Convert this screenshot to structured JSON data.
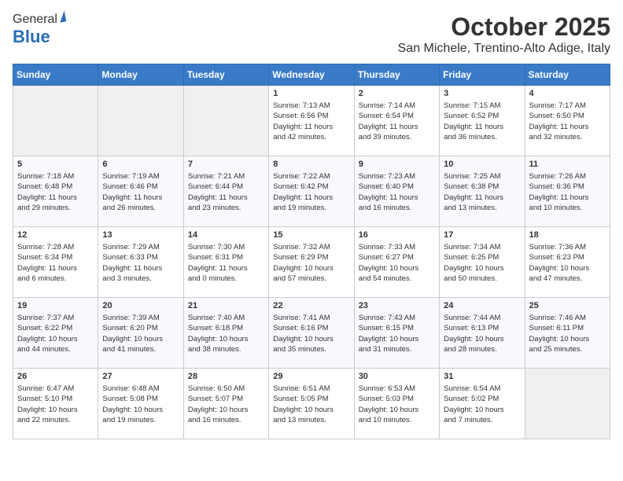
{
  "logo": {
    "general": "General",
    "blue": "Blue"
  },
  "header": {
    "month": "October 2025",
    "location": "San Michele, Trentino-Alto Adige, Italy"
  },
  "weekdays": [
    "Sunday",
    "Monday",
    "Tuesday",
    "Wednesday",
    "Thursday",
    "Friday",
    "Saturday"
  ],
  "weeks": [
    [
      {
        "day": "",
        "info": ""
      },
      {
        "day": "",
        "info": ""
      },
      {
        "day": "",
        "info": ""
      },
      {
        "day": "1",
        "info": "Sunrise: 7:13 AM\nSunset: 6:56 PM\nDaylight: 11 hours\nand 42 minutes."
      },
      {
        "day": "2",
        "info": "Sunrise: 7:14 AM\nSunset: 6:54 PM\nDaylight: 11 hours\nand 39 minutes."
      },
      {
        "day": "3",
        "info": "Sunrise: 7:15 AM\nSunset: 6:52 PM\nDaylight: 11 hours\nand 36 minutes."
      },
      {
        "day": "4",
        "info": "Sunrise: 7:17 AM\nSunset: 6:50 PM\nDaylight: 11 hours\nand 32 minutes."
      }
    ],
    [
      {
        "day": "5",
        "info": "Sunrise: 7:18 AM\nSunset: 6:48 PM\nDaylight: 11 hours\nand 29 minutes."
      },
      {
        "day": "6",
        "info": "Sunrise: 7:19 AM\nSunset: 6:46 PM\nDaylight: 11 hours\nand 26 minutes."
      },
      {
        "day": "7",
        "info": "Sunrise: 7:21 AM\nSunset: 6:44 PM\nDaylight: 11 hours\nand 23 minutes."
      },
      {
        "day": "8",
        "info": "Sunrise: 7:22 AM\nSunset: 6:42 PM\nDaylight: 11 hours\nand 19 minutes."
      },
      {
        "day": "9",
        "info": "Sunrise: 7:23 AM\nSunset: 6:40 PM\nDaylight: 11 hours\nand 16 minutes."
      },
      {
        "day": "10",
        "info": "Sunrise: 7:25 AM\nSunset: 6:38 PM\nDaylight: 11 hours\nand 13 minutes."
      },
      {
        "day": "11",
        "info": "Sunrise: 7:26 AM\nSunset: 6:36 PM\nDaylight: 11 hours\nand 10 minutes."
      }
    ],
    [
      {
        "day": "12",
        "info": "Sunrise: 7:28 AM\nSunset: 6:34 PM\nDaylight: 11 hours\nand 6 minutes."
      },
      {
        "day": "13",
        "info": "Sunrise: 7:29 AM\nSunset: 6:33 PM\nDaylight: 11 hours\nand 3 minutes."
      },
      {
        "day": "14",
        "info": "Sunrise: 7:30 AM\nSunset: 6:31 PM\nDaylight: 11 hours\nand 0 minutes."
      },
      {
        "day": "15",
        "info": "Sunrise: 7:32 AM\nSunset: 6:29 PM\nDaylight: 10 hours\nand 57 minutes."
      },
      {
        "day": "16",
        "info": "Sunrise: 7:33 AM\nSunset: 6:27 PM\nDaylight: 10 hours\nand 54 minutes."
      },
      {
        "day": "17",
        "info": "Sunrise: 7:34 AM\nSunset: 6:25 PM\nDaylight: 10 hours\nand 50 minutes."
      },
      {
        "day": "18",
        "info": "Sunrise: 7:36 AM\nSunset: 6:23 PM\nDaylight: 10 hours\nand 47 minutes."
      }
    ],
    [
      {
        "day": "19",
        "info": "Sunrise: 7:37 AM\nSunset: 6:22 PM\nDaylight: 10 hours\nand 44 minutes."
      },
      {
        "day": "20",
        "info": "Sunrise: 7:39 AM\nSunset: 6:20 PM\nDaylight: 10 hours\nand 41 minutes."
      },
      {
        "day": "21",
        "info": "Sunrise: 7:40 AM\nSunset: 6:18 PM\nDaylight: 10 hours\nand 38 minutes."
      },
      {
        "day": "22",
        "info": "Sunrise: 7:41 AM\nSunset: 6:16 PM\nDaylight: 10 hours\nand 35 minutes."
      },
      {
        "day": "23",
        "info": "Sunrise: 7:43 AM\nSunset: 6:15 PM\nDaylight: 10 hours\nand 31 minutes."
      },
      {
        "day": "24",
        "info": "Sunrise: 7:44 AM\nSunset: 6:13 PM\nDaylight: 10 hours\nand 28 minutes."
      },
      {
        "day": "25",
        "info": "Sunrise: 7:46 AM\nSunset: 6:11 PM\nDaylight: 10 hours\nand 25 minutes."
      }
    ],
    [
      {
        "day": "26",
        "info": "Sunrise: 6:47 AM\nSunset: 5:10 PM\nDaylight: 10 hours\nand 22 minutes."
      },
      {
        "day": "27",
        "info": "Sunrise: 6:48 AM\nSunset: 5:08 PM\nDaylight: 10 hours\nand 19 minutes."
      },
      {
        "day": "28",
        "info": "Sunrise: 6:50 AM\nSunset: 5:07 PM\nDaylight: 10 hours\nand 16 minutes."
      },
      {
        "day": "29",
        "info": "Sunrise: 6:51 AM\nSunset: 5:05 PM\nDaylight: 10 hours\nand 13 minutes."
      },
      {
        "day": "30",
        "info": "Sunrise: 6:53 AM\nSunset: 5:03 PM\nDaylight: 10 hours\nand 10 minutes."
      },
      {
        "day": "31",
        "info": "Sunrise: 6:54 AM\nSunset: 5:02 PM\nDaylight: 10 hours\nand 7 minutes."
      },
      {
        "day": "",
        "info": ""
      }
    ]
  ]
}
